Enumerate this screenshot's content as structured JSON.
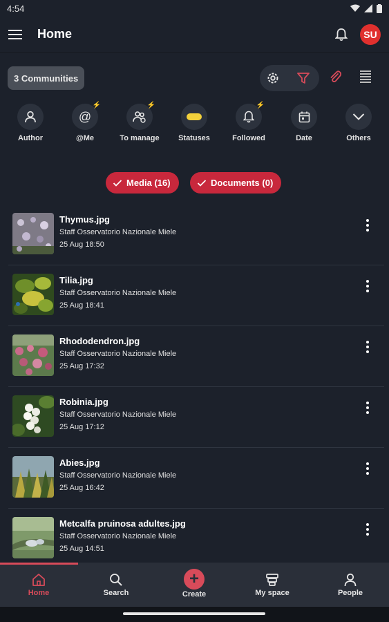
{
  "status": {
    "time": "4:54"
  },
  "header": {
    "title": "Home",
    "avatar_initials": "SU",
    "avatar_color": "#e0302e"
  },
  "toolbar": {
    "communities_label": "3 Communities"
  },
  "filters": [
    {
      "label": "Author",
      "icon": "person-icon"
    },
    {
      "label": "@Me",
      "icon": "at-icon"
    },
    {
      "label": "To manage",
      "icon": "group-icon"
    },
    {
      "label": "Statuses",
      "icon": "status-icon"
    },
    {
      "label": "Followed",
      "icon": "bell-icon"
    },
    {
      "label": "Date",
      "icon": "calendar-icon"
    },
    {
      "label": "Others",
      "icon": "chevron-down-icon"
    }
  ],
  "tabs": {
    "media": "Media (16)",
    "documents": "Documents (0)"
  },
  "files": [
    {
      "name": "Thymus.jpg",
      "author": "Staff Osservatorio Nazionale Miele",
      "date": "25 Aug 18:50"
    },
    {
      "name": "Tilia.jpg",
      "author": "Staff Osservatorio Nazionale Miele",
      "date": "25 Aug 18:41"
    },
    {
      "name": "Rhododendron.jpg",
      "author": "Staff Osservatorio Nazionale Miele",
      "date": "25 Aug 17:32"
    },
    {
      "name": "Robinia.jpg",
      "author": "Staff Osservatorio Nazionale Miele",
      "date": "25 Aug 17:12"
    },
    {
      "name": "Abies.jpg",
      "author": "Staff Osservatorio Nazionale Miele",
      "date": "25 Aug 16:42"
    },
    {
      "name": "Metcalfa pruinosa adultes.jpg",
      "author": "Staff Osservatorio Nazionale Miele",
      "date": "25 Aug 14:51"
    }
  ],
  "nav": [
    {
      "label": "Home"
    },
    {
      "label": "Search"
    },
    {
      "label": "Create"
    },
    {
      "label": "My space"
    },
    {
      "label": "People"
    }
  ],
  "colors": {
    "accent": "#d84b5a",
    "pill": "#c8283c",
    "background": "#1c212b",
    "status_yellow": "#f2d03b"
  }
}
